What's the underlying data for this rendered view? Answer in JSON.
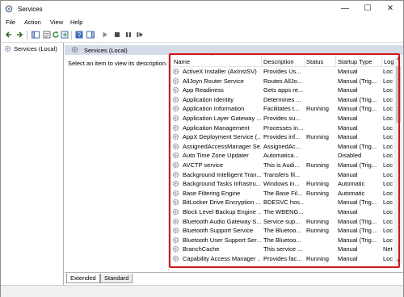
{
  "window": {
    "title": "Services",
    "minimize_glyph": "—",
    "maximize_glyph": "☐",
    "close_glyph": "✕"
  },
  "menu": [
    "File",
    "Action",
    "View",
    "Help"
  ],
  "toolbar": {
    "icons": [
      "back-icon",
      "forward-icon",
      "show-hide-console-tree-icon",
      "properties-icon",
      "refresh-icon",
      "export-list-icon",
      "help-icon",
      "show-action-pane-icon",
      "start-service-icon",
      "stop-service-icon",
      "pause-service-icon",
      "restart-service-icon"
    ]
  },
  "tree": {
    "item_label": "Services (Local)"
  },
  "pane": {
    "header": "Services (Local)",
    "description_hint": "Select an item to view its description."
  },
  "columns": [
    "Name",
    "Description",
    "Status",
    "Startup Type",
    "Log"
  ],
  "rows": [
    {
      "name": "ActiveX Installer (AxInstSV)",
      "desc": "Provides Us...",
      "status": "",
      "startup": "Manual",
      "log": "Loc"
    },
    {
      "name": "AllJoyn Router Service",
      "desc": "Routes AllJo...",
      "status": "",
      "startup": "Manual (Trig...",
      "log": "Loc"
    },
    {
      "name": "App Readiness",
      "desc": "Gets apps re...",
      "status": "",
      "startup": "Manual",
      "log": "Loc"
    },
    {
      "name": "Application Identity",
      "desc": "Determines ...",
      "status": "",
      "startup": "Manual (Trig...",
      "log": "Loc"
    },
    {
      "name": "Application Information",
      "desc": "Facilitates t...",
      "status": "Running",
      "startup": "Manual (Trig...",
      "log": "Loc"
    },
    {
      "name": "Application Layer Gateway ...",
      "desc": "Provides su...",
      "status": "",
      "startup": "Manual",
      "log": "Loc"
    },
    {
      "name": "Application Management",
      "desc": "Processes in...",
      "status": "",
      "startup": "Manual",
      "log": "Loc"
    },
    {
      "name": "AppX Deployment Service (...",
      "desc": "Provides inf...",
      "status": "Running",
      "startup": "Manual",
      "log": "Loc"
    },
    {
      "name": "AssignedAccessManager Se...",
      "desc": "AssignedAc...",
      "status": "",
      "startup": "Manual (Trig...",
      "log": "Loc"
    },
    {
      "name": "Auto Time Zone Updater",
      "desc": "Automatica...",
      "status": "",
      "startup": "Disabled",
      "log": "Loc"
    },
    {
      "name": "AVCTP service",
      "desc": "This is Audi...",
      "status": "Running",
      "startup": "Manual (Trig...",
      "log": "Loc"
    },
    {
      "name": "Background Intelligent Tran...",
      "desc": "Transfers fil...",
      "status": "",
      "startup": "Manual",
      "log": "Loc"
    },
    {
      "name": "Background Tasks Infrastru...",
      "desc": "Windows in...",
      "status": "Running",
      "startup": "Automatic",
      "log": "Loc"
    },
    {
      "name": "Base Filtering Engine",
      "desc": "The Base Fil...",
      "status": "Running",
      "startup": "Automatic",
      "log": "Loc"
    },
    {
      "name": "BitLocker Drive Encryption ...",
      "desc": "BDESVC hos...",
      "status": "",
      "startup": "Manual (Trig...",
      "log": "Loc"
    },
    {
      "name": "Block Level Backup Engine ...",
      "desc": "The WBENG...",
      "status": "",
      "startup": "Manual",
      "log": "Loc"
    },
    {
      "name": "Bluetooth Audio Gateway S...",
      "desc": "Service sup...",
      "status": "Running",
      "startup": "Manual (Trig...",
      "log": "Loc"
    },
    {
      "name": "Bluetooth Support Service",
      "desc": "The Bluetoo...",
      "status": "Running",
      "startup": "Manual (Trig...",
      "log": "Loc"
    },
    {
      "name": "Bluetooth User Support Ser...",
      "desc": "The Bluetoo...",
      "status": "",
      "startup": "Manual (Trig...",
      "log": "Loc"
    },
    {
      "name": "BranchCache",
      "desc": "This service ...",
      "status": "",
      "startup": "Manual",
      "log": "Net"
    },
    {
      "name": "Capability Access Manager ...",
      "desc": "Provides fac...",
      "status": "Running",
      "startup": "Manual",
      "log": "Loc"
    }
  ],
  "tabs": [
    "Extended",
    "Standard"
  ],
  "colors": {
    "highlight": "#d01818",
    "pane_header": "#d6dbe9",
    "gear": "#7a8ea8"
  }
}
